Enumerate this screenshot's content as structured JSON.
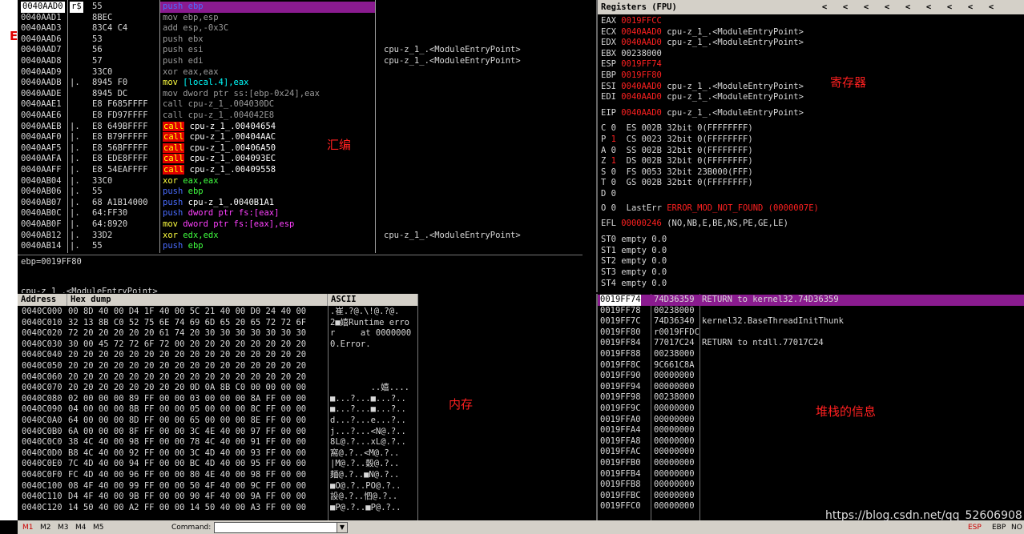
{
  "disasm": {
    "rows": [
      {
        "addr": "0040AAD0",
        "mk": "r$",
        "hex": "55",
        "op": "push",
        "args": "ebp",
        "cmt": "",
        "cls": "push",
        "sel": true
      },
      {
        "addr": "0040AAD1",
        "mk": "",
        "hex": "8BEC",
        "op": "mov",
        "args": "ebp,esp",
        "cmt": "",
        "cls": "gray"
      },
      {
        "addr": "0040AAD3",
        "mk": "",
        "hex": "83C4 C4",
        "op": "add",
        "args": "esp,-0x3C",
        "cmt": "",
        "cls": "gray"
      },
      {
        "addr": "0040AAD6",
        "mk": "",
        "hex": "53",
        "op": "push",
        "args": "ebx",
        "cmt": "",
        "cls": "gray"
      },
      {
        "addr": "0040AAD7",
        "mk": "",
        "hex": "56",
        "op": "push",
        "args": "esi",
        "cmt": "cpu-z_1_.<ModuleEntryPoint>",
        "cls": "gray"
      },
      {
        "addr": "0040AAD8",
        "mk": "",
        "hex": "57",
        "op": "push",
        "args": "edi",
        "cmt": "cpu-z_1_.<ModuleEntryPoint>",
        "cls": "gray"
      },
      {
        "addr": "0040AAD9",
        "mk": "",
        "hex": "33C0",
        "op": "xor",
        "args": "eax,eax",
        "cmt": "",
        "cls": "gray"
      },
      {
        "addr": "0040AADB",
        "mk": "|.",
        "hex": "8945 F0",
        "op": "mov",
        "args": "[local.4],eax",
        "cmt": "",
        "cls": "movlocal"
      },
      {
        "addr": "0040AADE",
        "mk": "",
        "hex": "8945 DC",
        "op": "mov",
        "args": "dword ptr ss:[ebp-0x24],eax",
        "cmt": "",
        "cls": "gray"
      },
      {
        "addr": "0040AAE1",
        "mk": "",
        "hex": "E8 F685FFFF",
        "op": "call",
        "args": "cpu-z_1_.004030DC",
        "cmt": "",
        "cls": "gray"
      },
      {
        "addr": "0040AAE6",
        "mk": "",
        "hex": "E8 FD97FFFF",
        "op": "call",
        "args": "cpu-z_1_.004042E8",
        "cmt": "",
        "cls": "gray"
      },
      {
        "addr": "0040AAEB",
        "mk": "|.",
        "hex": "E8 649BFFFF",
        "op": "call",
        "args": "cpu-z_1_.00404654",
        "cmt": "",
        "cls": "call"
      },
      {
        "addr": "0040AAF0",
        "mk": "|.",
        "hex": "E8 B79FFFFF",
        "op": "call",
        "args": "cpu-z_1_.00404AAC",
        "cmt": "",
        "cls": "call"
      },
      {
        "addr": "0040AAF5",
        "mk": "|.",
        "hex": "E8 56BFFFFF",
        "op": "call",
        "args": "cpu-z_1_.00406A50",
        "cmt": "",
        "cls": "call"
      },
      {
        "addr": "0040AAFA",
        "mk": "|.",
        "hex": "E8 EDE8FFFF",
        "op": "call",
        "args": "cpu-z_1_.004093EC",
        "cmt": "",
        "cls": "call"
      },
      {
        "addr": "0040AAFF",
        "mk": "|.",
        "hex": "E8 54EAFFFF",
        "op": "call",
        "args": "cpu-z_1_.00409558",
        "cmt": "",
        "cls": "call"
      },
      {
        "addr": "0040AB04",
        "mk": "|.",
        "hex": "33C0",
        "op": "xor",
        "args": "eax,eax",
        "cmt": "",
        "cls": "xor"
      },
      {
        "addr": "0040AB06",
        "mk": "|.",
        "hex": "55",
        "op": "push",
        "args": "ebp",
        "cmt": "",
        "cls": "pushreg"
      },
      {
        "addr": "0040AB07",
        "mk": "|.",
        "hex": "68 A1B14000",
        "op": "push",
        "args": "cpu-z_1_.0040B1A1",
        "cmt": "",
        "cls": "pushimm"
      },
      {
        "addr": "0040AB0C",
        "mk": "|.",
        "hex": "64:FF30",
        "op": "push",
        "args": "dword ptr fs:[eax]",
        "cmt": "",
        "cls": "pushmem"
      },
      {
        "addr": "0040AB0F",
        "mk": "|.",
        "hex": "64:8920",
        "op": "mov",
        "args": "dword ptr fs:[eax],esp",
        "cmt": "",
        "cls": "movmem"
      },
      {
        "addr": "0040AB12",
        "mk": "|.",
        "hex": "33D2",
        "op": "xor",
        "args": "edx,edx",
        "cmt": "cpu-z_1_.<ModuleEntryPoint>",
        "cls": "xor"
      },
      {
        "addr": "0040AB14",
        "mk": "|.",
        "hex": "55",
        "op": "push",
        "args": "ebp",
        "cmt": "",
        "cls": "pushreg"
      }
    ],
    "annotation": "汇编"
  },
  "info": {
    "line1": "ebp=0019FF80",
    "line2": "cpu-z_1_.<ModuleEntryPoint>"
  },
  "registers": {
    "title": "Registers (FPU)",
    "arrows": [
      "<",
      "<",
      "<",
      "<",
      "<",
      "<",
      "<",
      "<",
      "<"
    ],
    "annotation": "寄存器",
    "lines": [
      {
        "name": "EAX",
        "val": "0019FFCC",
        "rest": "",
        "red": true
      },
      {
        "name": "ECX",
        "val": "0040AAD0",
        "rest": "cpu-z_1_.<ModuleEntryPoint>",
        "red": true
      },
      {
        "name": "EDX",
        "val": "0040AAD0",
        "rest": "cpu-z_1_.<ModuleEntryPoint>",
        "red": true
      },
      {
        "name": "EBX",
        "val": "00238000",
        "rest": "",
        "red": false
      },
      {
        "name": "ESP",
        "val": "0019FF74",
        "rest": "",
        "red": true
      },
      {
        "name": "EBP",
        "val": "0019FF80",
        "rest": "",
        "red": true
      },
      {
        "name": "ESI",
        "val": "0040AAD0",
        "rest": "cpu-z_1_.<ModuleEntryPoint>",
        "red": true
      },
      {
        "name": "EDI",
        "val": "0040AAD0",
        "rest": "cpu-z_1_.<ModuleEntryPoint>",
        "red": true
      },
      {
        "name": "EIP",
        "val": "0040AAD0",
        "rest": "cpu-z_1_.<ModuleEntryPoint>",
        "red": true
      }
    ],
    "flags": [
      {
        "f": "C",
        "v": "0",
        "seg": "ES 002B 32bit 0(FFFFFFFF)",
        "red": false
      },
      {
        "f": "P",
        "v": "1",
        "seg": "CS 0023 32bit 0(FFFFFFFF)",
        "red": true
      },
      {
        "f": "A",
        "v": "0",
        "seg": "SS 002B 32bit 0(FFFFFFFF)",
        "red": false
      },
      {
        "f": "Z",
        "v": "1",
        "seg": "DS 002B 32bit 0(FFFFFFFF)",
        "red": true
      },
      {
        "f": "S",
        "v": "0",
        "seg": "FS 0053 32bit 23B000(FFF)",
        "red": false
      },
      {
        "f": "T",
        "v": "0",
        "seg": "GS 002B 32bit 0(FFFFFFFF)",
        "red": false
      },
      {
        "f": "D",
        "v": "0",
        "seg": "",
        "red": false
      },
      {
        "f": "O",
        "v": "0",
        "seg": "LastErr",
        "red": false
      }
    ],
    "lasterr": "ERROR_MOD_NOT_FOUND (0000007E)",
    "efl_label": "EFL",
    "efl_val": "00000246",
    "efl_rest": "(NO,NB,E,BE,NS,PE,GE,LE)",
    "fpu": [
      "ST0 empty 0.0",
      "ST1 empty 0.0",
      "ST2 empty 0.0",
      "ST3 empty 0.0",
      "ST4 empty 0.0"
    ]
  },
  "dump": {
    "headers": {
      "address": "Address",
      "hex": "Hex dump",
      "ascii": "ASCII"
    },
    "annotation": "内存",
    "rows": [
      {
        "addr": "0040C000",
        "hex": "00 8D 40 00 D4 1F 40 00 5C 21 40 00 D0 24 40 00",
        "asc": ".崔.?@.\\!@.?@."
      },
      {
        "addr": "0040C010",
        "hex": "32 13 8B C0 52 75 6E 74 69 6D 65 20 65 72 72 6F",
        "asc": "2■嬉Runtime erro"
      },
      {
        "addr": "0040C020",
        "hex": "72 20 20 20 20 20 61 74 20 30 30 30 30 30 30 30",
        "asc": "r     at 0000000"
      },
      {
        "addr": "0040C030",
        "hex": "30 00 45 72 72 6F 72 00 20 20 20 20 20 20 20 20",
        "asc": "0.Error.        "
      },
      {
        "addr": "0040C040",
        "hex": "20 20 20 20 20 20 20 20 20 20 20 20 20 20 20 20",
        "asc": ""
      },
      {
        "addr": "0040C050",
        "hex": "20 20 20 20 20 20 20 20 20 20 20 20 20 20 20 20",
        "asc": ""
      },
      {
        "addr": "0040C060",
        "hex": "20 20 20 20 20 20 20 20 20 20 20 20 20 20 20 20",
        "asc": ""
      },
      {
        "addr": "0040C070",
        "hex": "20 20 20 20 20 20 20 20 0D 0A 8B C0 00 00 00 00",
        "asc": "        ..嬉...."
      },
      {
        "addr": "0040C080",
        "hex": "02 00 00 00 89 FF 00 00 03 00 00 00 8A FF 00 00",
        "asc": "■...?...■...?.."
      },
      {
        "addr": "0040C090",
        "hex": "04 00 00 00 8B FF 00 00 05 00 00 00 8C FF 00 00",
        "asc": "■...?...■...?.."
      },
      {
        "addr": "0040C0A0",
        "hex": "64 00 00 00 8D FF 00 00 65 00 00 00 8E FF 00 00",
        "asc": "d...?...e...?.."
      },
      {
        "addr": "0040C0B0",
        "hex": "6A 00 00 00 8F FF 00 00 3C 4E 40 00 97 FF 00 00",
        "asc": "j...?...<N@.?.."
      },
      {
        "addr": "0040C0C0",
        "hex": "38 4C 40 00 98 FF 00 00 78 4C 40 00 91 FF 00 00",
        "asc": "8L@.?...xL@.?.."
      },
      {
        "addr": "0040C0D0",
        "hex": "B8 4C 40 00 92 FF 00 00 3C 4D 40 00 93 FF 00 00",
        "asc": "窩@.?..<M@.?.."
      },
      {
        "addr": "0040C0E0",
        "hex": "7C 4D 40 00 94 FF 00 00 BC 4D 40 00 95 FF 00 00",
        "asc": "|M@.?..糓@.?.."
      },
      {
        "addr": "0040C0F0",
        "hex": "FC 4D 40 00 96 FF 00 00 80 4E 40 00 98 FF 00 00",
        "asc": "麺@.?..■N@.?.."
      },
      {
        "addr": "0040C100",
        "hex": "08 4F 40 00 99 FF 00 00 50 4F 40 00 9C FF 00 00",
        "asc": "■O@.?..PO@.?.."
      },
      {
        "addr": "0040C110",
        "hex": "D4 4F 40 00 9B FF 00 00 90 4F 40 00 9A FF 00 00",
        "asc": "設@.?..怬@.?.."
      },
      {
        "addr": "0040C120",
        "hex": "14 50 40 00 A2 FF 00 00 14 50 40 00 A3 FF 00 00",
        "asc": "■P@.?..■P@.?.."
      }
    ]
  },
  "stack": {
    "annotation": "堆栈的信息",
    "rows": [
      {
        "a": "0019FF74",
        "v": "74D36359",
        "c": "RETURN to kernel32.74D36359",
        "sel": true
      },
      {
        "a": "0019FF78",
        "v": "00238000",
        "c": ""
      },
      {
        "a": "0019FF7C",
        "v": "74D36340",
        "c": "kernel32.BaseThreadInitThunk"
      },
      {
        "a": "0019FF80",
        "v": "r0019FFDC",
        "c": ""
      },
      {
        "a": "0019FF84",
        "v": "77017C24",
        "c": "RETURN to ntdll.77017C24"
      },
      {
        "a": "0019FF88",
        "v": "00238000",
        "c": ""
      },
      {
        "a": "0019FF8C",
        "v": "9C661C8A",
        "c": ""
      },
      {
        "a": "0019FF90",
        "v": "00000000",
        "c": ""
      },
      {
        "a": "0019FF94",
        "v": "00000000",
        "c": ""
      },
      {
        "a": "0019FF98",
        "v": "00238000",
        "c": ""
      },
      {
        "a": "0019FF9C",
        "v": "00000000",
        "c": ""
      },
      {
        "a": "0019FFA0",
        "v": "00000000",
        "c": ""
      },
      {
        "a": "0019FFA4",
        "v": "00000000",
        "c": ""
      },
      {
        "a": "0019FFA8",
        "v": "00000000",
        "c": ""
      },
      {
        "a": "0019FFAC",
        "v": "00000000",
        "c": ""
      },
      {
        "a": "0019FFB0",
        "v": "00000000",
        "c": ""
      },
      {
        "a": "0019FFB4",
        "v": "00000000",
        "c": ""
      },
      {
        "a": "0019FFB8",
        "v": "00000000",
        "c": ""
      },
      {
        "a": "0019FFBC",
        "v": "00000000",
        "c": ""
      },
      {
        "a": "0019FFC0",
        "v": "00000000",
        "c": ""
      }
    ]
  },
  "bottombar": {
    "buttons": [
      "M1",
      "M2",
      "M3",
      "M4",
      "M5"
    ],
    "command_label": "Command:",
    "right": [
      "ESP",
      "EBP",
      "NO"
    ]
  },
  "watermark": "https://blog.csdn.net/qq_52606908",
  "left_mark": "E"
}
